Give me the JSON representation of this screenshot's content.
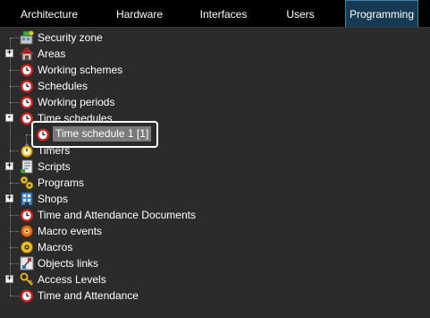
{
  "tabs": [
    {
      "label": "Architecture",
      "active": false
    },
    {
      "label": "Hardware",
      "active": false
    },
    {
      "label": "Interfaces",
      "active": false
    },
    {
      "label": "Users",
      "active": false
    },
    {
      "label": "Programming",
      "active": true
    }
  ],
  "tree": {
    "items": [
      {
        "label": "Security zone",
        "icon": "security-zone-icon",
        "expander": ""
      },
      {
        "label": "Areas",
        "icon": "house-icon",
        "expander": "+"
      },
      {
        "label": "Working schemes",
        "icon": "clock-icon",
        "expander": ""
      },
      {
        "label": "Schedules",
        "icon": "clock-icon",
        "expander": ""
      },
      {
        "label": "Working periods",
        "icon": "clock-icon",
        "expander": ""
      },
      {
        "label": "Time schedules",
        "icon": "clock-icon",
        "expander": "-"
      },
      {
        "label": "Time schedule 1 [1]",
        "icon": "clock-icon",
        "expander": "",
        "selected": true
      },
      {
        "label": "Timers",
        "icon": "stopwatch-icon",
        "expander": ""
      },
      {
        "label": "Scripts",
        "icon": "script-icon",
        "expander": "+"
      },
      {
        "label": "Programs",
        "icon": "gears-icon",
        "expander": ""
      },
      {
        "label": "Shops",
        "icon": "shop-icon",
        "expander": "+"
      },
      {
        "label": "Time and Attendance Documents",
        "icon": "clock-icon",
        "expander": ""
      },
      {
        "label": "Macro events",
        "icon": "macro-event-icon",
        "expander": ""
      },
      {
        "label": "Macros",
        "icon": "macro-icon",
        "expander": ""
      },
      {
        "label": "Objects links",
        "icon": "link-icon",
        "expander": ""
      },
      {
        "label": "Access Levels",
        "icon": "key-icon",
        "expander": "+"
      },
      {
        "label": "Time and Attendance",
        "icon": "clock-icon",
        "expander": ""
      }
    ]
  },
  "colors": {
    "background": "#2b2b2b",
    "tabbar": "#000000",
    "active_tab": "#163a52",
    "clock_red": "#d42020",
    "selection": "#7a7a7a"
  }
}
